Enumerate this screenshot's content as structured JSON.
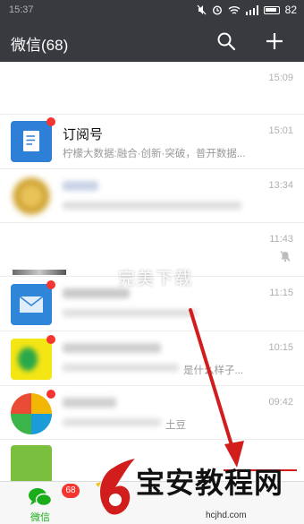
{
  "status_bar": {
    "time": "15:37",
    "battery": "82"
  },
  "header": {
    "title": "微信(68)"
  },
  "chats": [
    {
      "name": "",
      "preview": "",
      "time": "15:09"
    },
    {
      "name": "订阅号",
      "preview": "柠檬大数据:融合·创新·突破，普开数据...",
      "time": "15:01"
    },
    {
      "name": "",
      "preview": "",
      "time": "13:34"
    },
    {
      "name": "",
      "preview": "",
      "time": "11:43"
    },
    {
      "name": "",
      "preview": "",
      "time": "11:15"
    },
    {
      "name": "",
      "preview": "是什么样子...",
      "time": "10:15"
    },
    {
      "name": "",
      "preview": "土豆",
      "time": "09:42"
    }
  ],
  "tabs": {
    "wechat_label": "微信",
    "wechat_badge": "68"
  },
  "watermark": "完美下载",
  "overlay": {
    "brand": "宝安教程网",
    "url": "hcjhd.com"
  },
  "colors": {
    "header_bg": "#393a3f",
    "badge": "#f43530",
    "wechat_green": "#1aad19",
    "arrow_red": "#d21d1d"
  }
}
